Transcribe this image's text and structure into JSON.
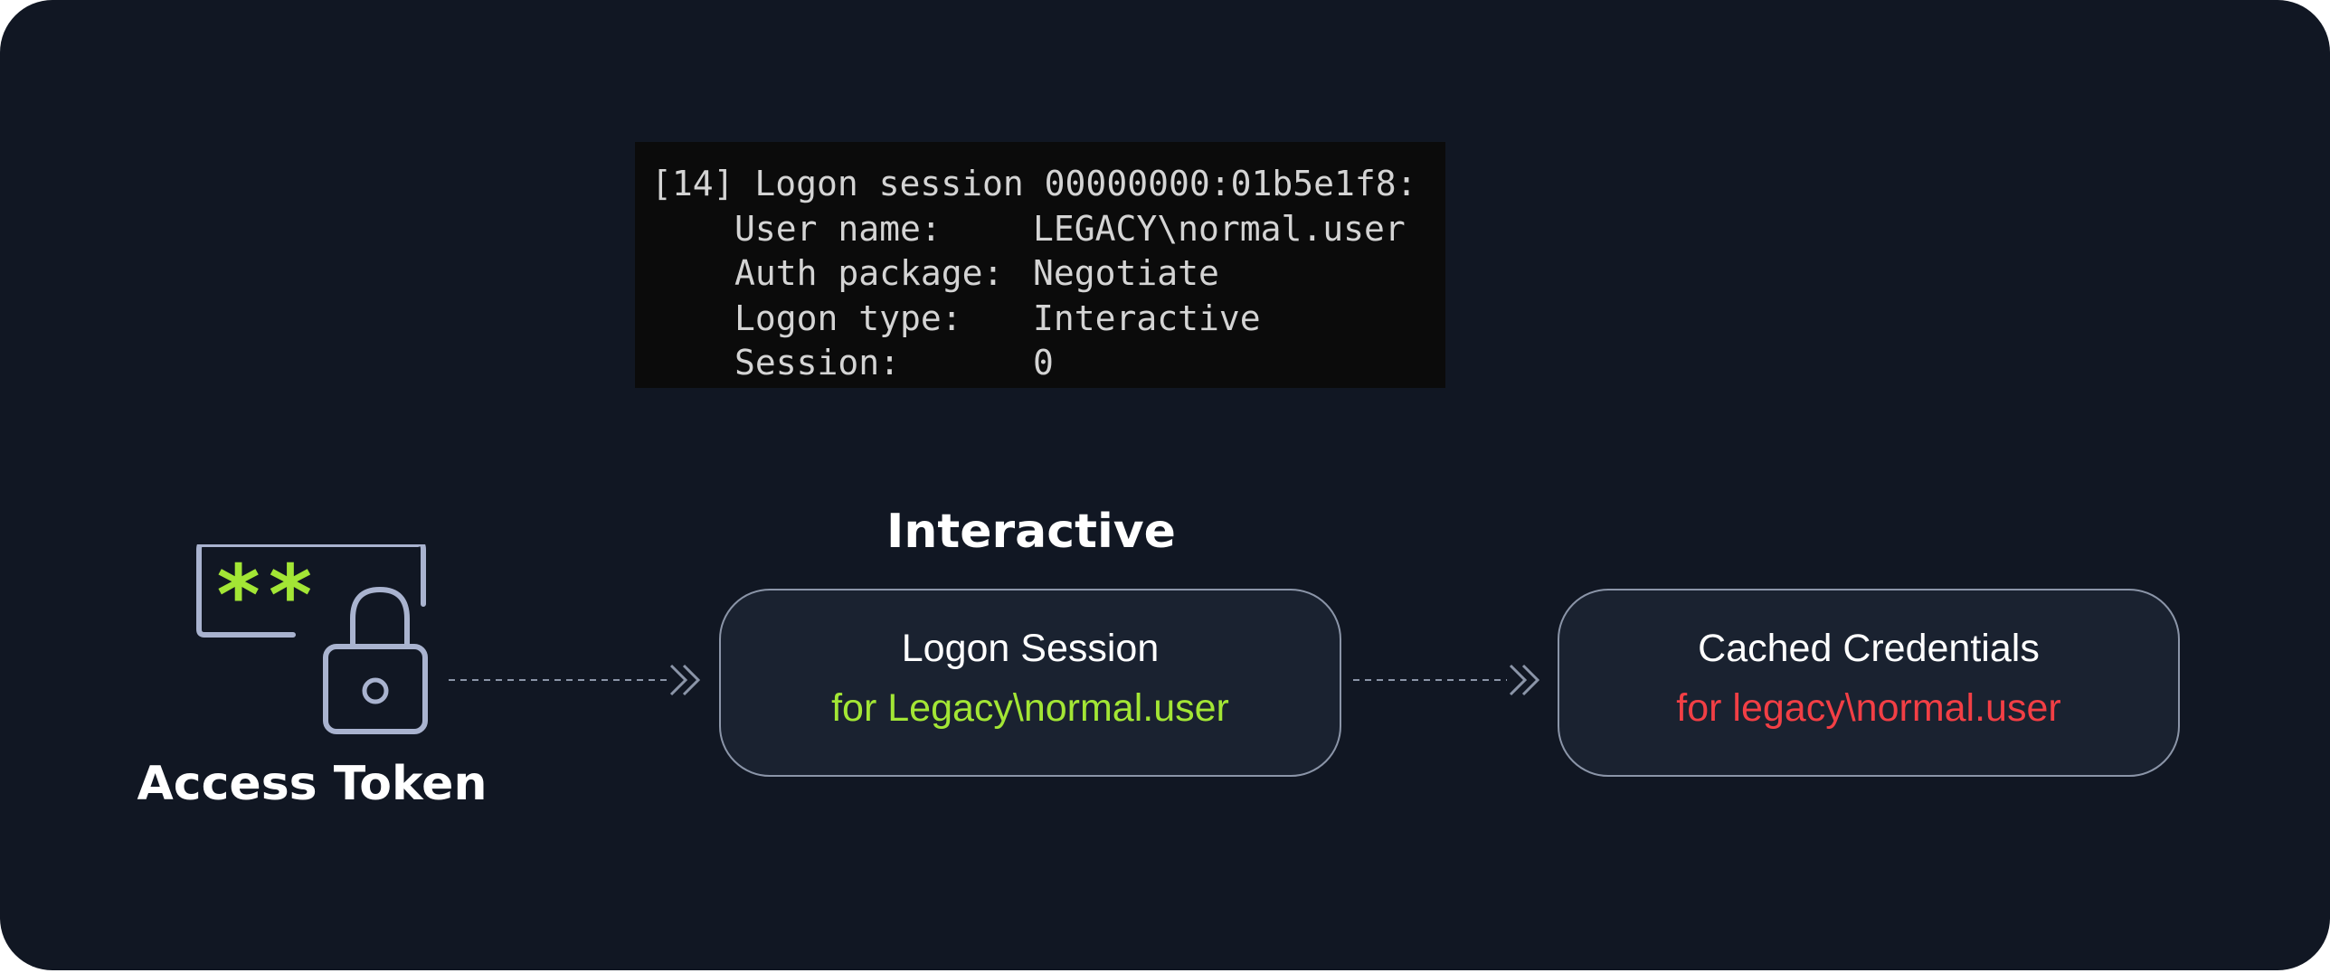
{
  "terminal": {
    "header": "[14] Logon session 00000000:01b5e1f8:",
    "rows": [
      {
        "key": "User name:",
        "value": "LEGACY\\normal.user"
      },
      {
        "key": "Auth package:",
        "value": "Negotiate"
      },
      {
        "key": "Logon type:",
        "value": "Interactive"
      },
      {
        "key": "Session:",
        "value": "0"
      }
    ]
  },
  "access_token": {
    "label": "Access Token",
    "password_mask": "**"
  },
  "logon_type_label": "Interactive",
  "nodes": {
    "logon_session": {
      "title": "Logon Session",
      "subtitle": "for Legacy\\normal.user"
    },
    "cached_credentials": {
      "title": "Cached Credentials",
      "subtitle": "for legacy\\normal.user"
    }
  },
  "colors": {
    "background": "#111723",
    "node_fill": "#1a2230",
    "node_border": "#8b95a8",
    "accent_green": "#a3e635",
    "accent_red": "#f23f45",
    "icon_stroke": "#a9b3cf",
    "connector": "#8b95a8"
  }
}
